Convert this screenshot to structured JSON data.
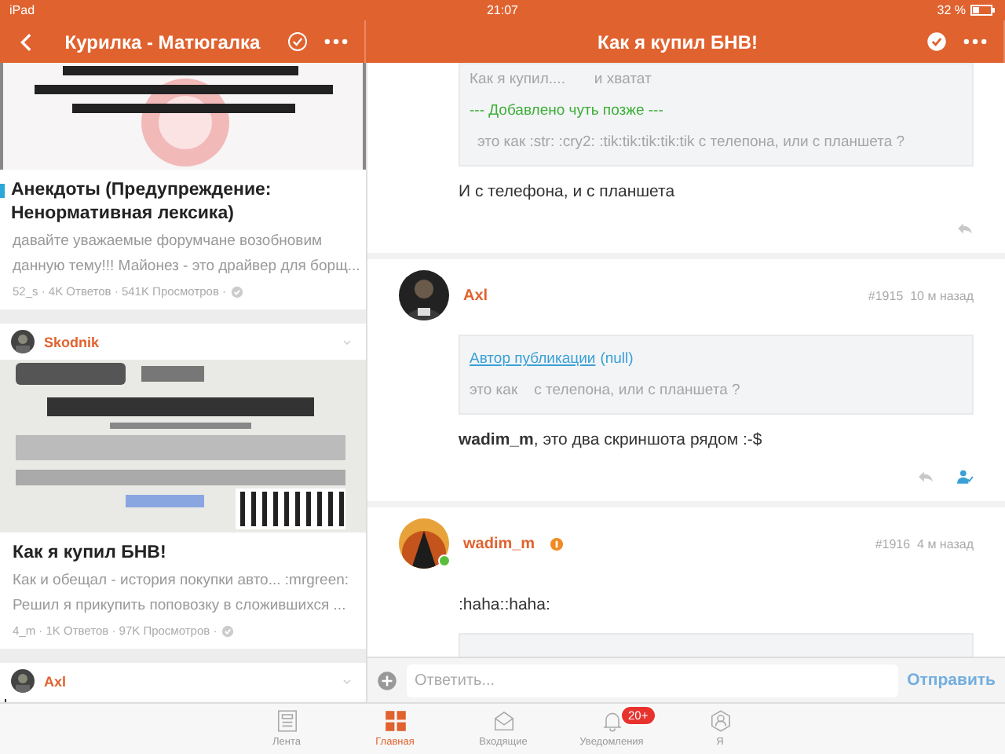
{
  "status_bar": {
    "device": "iPad",
    "time": "21:07",
    "battery": "32 %"
  },
  "left_panel": {
    "title": "Курилка - Матюгалка",
    "followed": false,
    "topics": [
      {
        "kind": "meme",
        "unread": true,
        "title": "Анекдоты (Предупреждение: Ненормативная лексика)",
        "excerpt_lines": [
          "давайте уважаемые форумчане возобновим",
          "данную тему!!! Майонез - это драйвер для борщ..."
        ],
        "meta": "52_s · 4K Ответов · 541K Просмотров ·"
      },
      {
        "author": "Skodnik",
        "kind": "package",
        "unread": false,
        "title": "Как я купил БНВ!",
        "excerpt_lines": [
          "Как и обещал - история покупки авто... :mrgreen:",
          "Решил я прикупить поповозку в сложившихся ..."
        ],
        "meta": "4_m · 1K Ответов · 97K Просмотров ·"
      },
      {
        "author": "Axl",
        "kind": "book"
      }
    ]
  },
  "right_panel": {
    "title": "Как я купил БНВ!",
    "followed": true,
    "posts": [
      {
        "quote": [
          {
            "kind": "plain",
            "text": "Как я купил....       и хватат"
          },
          {
            "kind": "added",
            "text": "--- Добавлено чуть позже ---"
          },
          {
            "kind": "plain",
            "text": "это как :str: :cry2: :tik:tik:tik:tik:tik с телепона, или с планшета ?"
          }
        ],
        "body": "И с телефона, и с планшета",
        "actions": [
          {
            "kind": "reply"
          }
        ]
      },
      {
        "author": "Axl",
        "number": "#1915",
        "time": "10 м назад",
        "quote": [
          {
            "kind": "source",
            "link": "Автор публикации",
            "text": "(null)"
          },
          {
            "kind": "plain",
            "text": "это как    с телепона, или с планшета ?"
          }
        ],
        "body": "**wadim_m**, это два скриншота рядом :-$",
        "actions": [
          {
            "kind": "reply"
          },
          {
            "kind": "mention"
          }
        ]
      },
      {
        "author": "wadim_m",
        "online": true,
        "badge": true,
        "number": "#1916",
        "time": "4 м назад",
        "body": ":haha::haha:",
        "trailing_quote": true
      }
    ],
    "reply_bar": {
      "placeholder": "Ответить...",
      "send": "Отправить"
    }
  },
  "tabs": [
    {
      "kind": "feed",
      "label": "Лента",
      "selected": false
    },
    {
      "kind": "grid",
      "label": "Главная",
      "selected": true
    },
    {
      "kind": "inbox",
      "label": "Входящие",
      "selected": false
    },
    {
      "kind": "bell",
      "label": "Уведомления",
      "selected": false,
      "badge": "20+"
    },
    {
      "kind": "person",
      "label": "Я",
      "selected": false
    }
  ]
}
